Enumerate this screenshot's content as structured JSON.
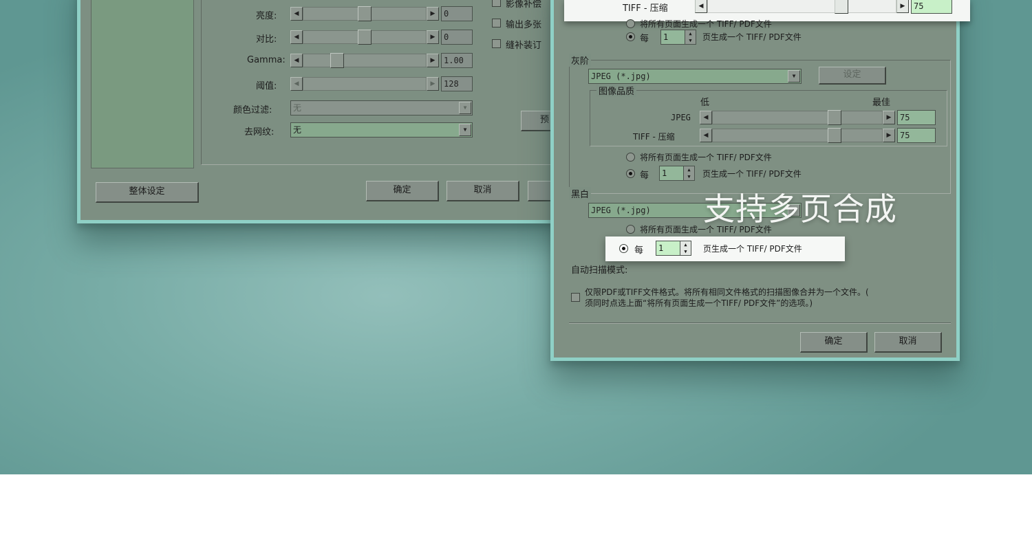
{
  "left_dialog": {
    "sliders": [
      {
        "label": "亮度:",
        "value": "0"
      },
      {
        "label": "对比:",
        "value": "0"
      },
      {
        "label": "Gamma:",
        "value": "1.00"
      },
      {
        "label": "阈值:",
        "value": "128"
      }
    ],
    "color_filter": {
      "label": "颜色过滤:",
      "value": "无"
    },
    "descreen": {
      "label": "去网纹:",
      "value": "无"
    },
    "checkboxes": [
      "影像补偿",
      "输出多张",
      "缝补装订"
    ],
    "partial_button": "预",
    "buttons": {
      "overall": "整体设定",
      "ok": "确定",
      "cancel": "取消"
    }
  },
  "right_dialog": {
    "top": {
      "tiff_label": "TIFF - 压缩",
      "tiff_value": "75",
      "radio_all": "将所有页面生成一个 TIFF/ PDF文件",
      "radio_each_prefix": "每",
      "radio_each_value": "1",
      "radio_each_suffix": "页生成一个 TIFF/ PDF文件"
    },
    "gray": {
      "title": "灰阶",
      "format": "JPEG (*.jpg)",
      "settings_button": "设定",
      "quality": {
        "title": "图像品质",
        "low": "低",
        "best": "最佳",
        "jpeg_label": "JPEG",
        "jpeg_value": "75",
        "tiff_label": "TIFF - 压缩",
        "tiff_value": "75"
      },
      "radio_all": "将所有页面生成一个 TIFF/ PDF文件",
      "radio_each_prefix": "每",
      "radio_each_value": "1",
      "radio_each_suffix": "页生成一个 TIFF/ PDF文件"
    },
    "bw": {
      "title": "黑白",
      "format": "JPEG (*.jpg)",
      "radio_all": "将所有页面生成一个 TIFF/ PDF文件",
      "radio_each_prefix": "每",
      "radio_each_value": "1",
      "radio_each_suffix": "页生成一个 TIFF/ PDF文件"
    },
    "auto_mode": {
      "label": "自动扫描模式:",
      "line1": "仅限PDF或TIFF文件格式。将所有相同文件格式的扫描图像合并为一个文件。(",
      "line2": "须同时点选上面“将所有页面生成一个TIFF/ PDF文件”的选项。)"
    },
    "buttons": {
      "ok": "确定",
      "cancel": "取消"
    }
  },
  "overlay_caption": "支持多页合成",
  "colors": {
    "background": "#78aca6",
    "window_frame": "#8fd0c6",
    "highlight_field": "#93b79a"
  }
}
